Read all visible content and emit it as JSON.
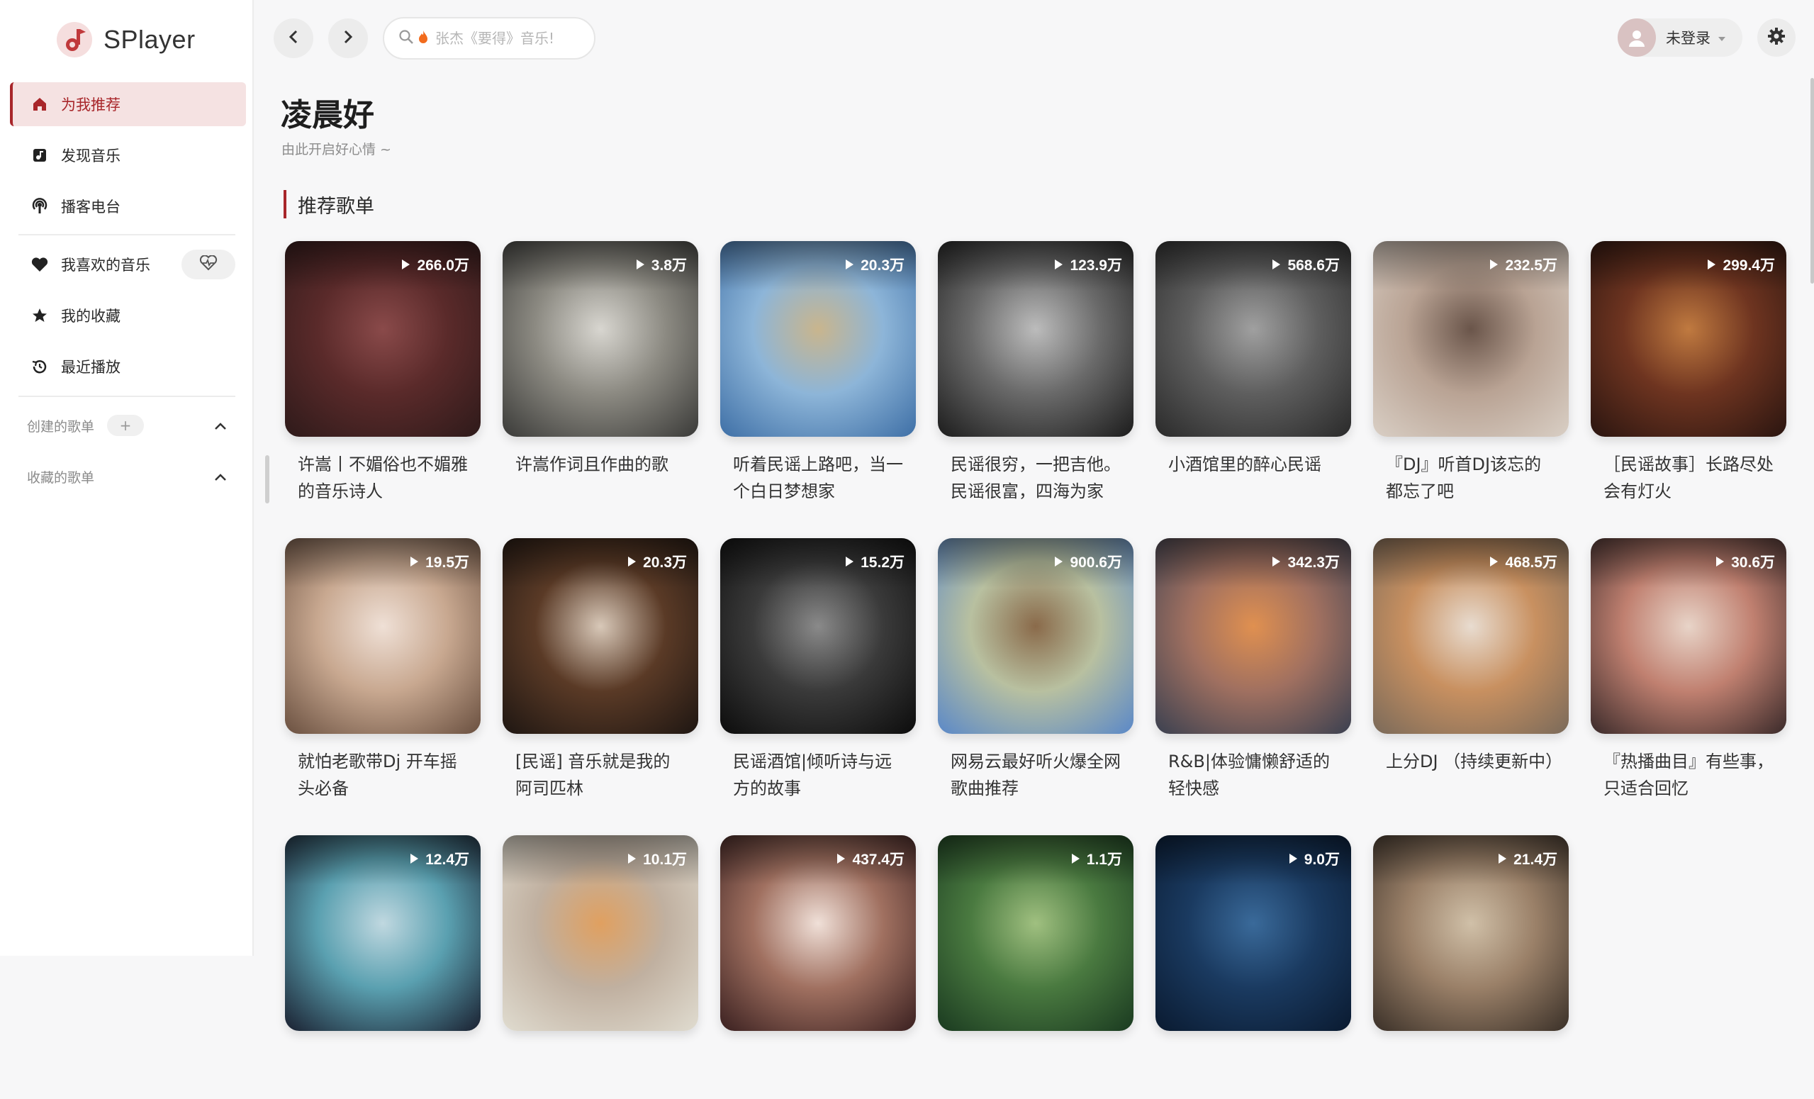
{
  "app": {
    "name": "SPlayer"
  },
  "sidebar": {
    "nav": [
      {
        "label": "为我推荐",
        "icon": "home-icon"
      },
      {
        "label": "发现音乐",
        "icon": "music-note-icon"
      },
      {
        "label": "播客电台",
        "icon": "podcast-icon"
      }
    ],
    "library": [
      {
        "label": "我喜欢的音乐",
        "icon": "heart-icon"
      },
      {
        "label": "我的收藏",
        "icon": "star-icon"
      },
      {
        "label": "最近播放",
        "icon": "history-icon"
      }
    ],
    "created_playlists": "创建的歌单",
    "collected_playlists": "收藏的歌单",
    "plus_label": "+"
  },
  "topbar": {
    "search_placeholder": "张杰《要得》音乐!",
    "user_label": "未登录"
  },
  "main": {
    "greeting": "凌晨好",
    "subtitle": "由此开启好心情 ~",
    "section_title": "推荐歌单",
    "playlists": [
      {
        "count": "266.0万",
        "title": "许嵩丨不媚俗也不媚雅的音乐诗人",
        "colors": [
          "#2e1a1a",
          "#5a2a2a",
          "#8a4a4a"
        ]
      },
      {
        "count": "3.8万",
        "title": "许嵩作词且作曲的歌",
        "colors": [
          "#3a3a38",
          "#8c8a82",
          "#d8d6d0"
        ]
      },
      {
        "count": "20.3万",
        "title": "听着民谣上路吧，当一个白日梦想家",
        "colors": [
          "#3e6fa6",
          "#8db5d8",
          "#c9b58d"
        ]
      },
      {
        "count": "123.9万",
        "title": "民谣很穷，一把吉他。民谣很富，四海为家",
        "colors": [
          "#1c1c1c",
          "#6a6a6a",
          "#bcbcbc"
        ]
      },
      {
        "count": "568.6万",
        "title": "小酒馆里的醉心民谣",
        "colors": [
          "#2a2a2a",
          "#5e5e5e",
          "#a0a0a0"
        ]
      },
      {
        "count": "232.5万",
        "title": "『DJ』听首DJ该忘的都忘了吧",
        "colors": [
          "#d9cfc5",
          "#b9a394",
          "#6a554a"
        ]
      },
      {
        "count": "299.4万",
        "title": "［民谣故事］长路尽处会有灯火",
        "colors": [
          "#2a1510",
          "#6e3420",
          "#c07a40"
        ]
      },
      {
        "count": "19.5万",
        "title": "就怕老歌带Dj 开车摇头必备",
        "colors": [
          "#6a5040",
          "#c8a890",
          "#efe0d6"
        ]
      },
      {
        "count": "20.3万",
        "title": "[民谣] 音乐就是我的阿司匹林",
        "colors": [
          "#1e1612",
          "#5a3a26",
          "#d8c8b8"
        ]
      },
      {
        "count": "15.2万",
        "title": "民谣酒馆|倾听诗与远方的故事",
        "colors": [
          "#0c0c0c",
          "#3a3a3a",
          "#8a8a8a"
        ]
      },
      {
        "count": "900.6万",
        "title": "网易云最好听火爆全网歌曲推荐",
        "colors": [
          "#5a88c8",
          "#b8c0a0",
          "#8a6a4a"
        ]
      },
      {
        "count": "342.3万",
        "title": "R&B|体验慵懒舒适的轻快感",
        "colors": [
          "#3a4050",
          "#a07060",
          "#e09050"
        ]
      },
      {
        "count": "468.5万",
        "title": "上分DJ （持续更新中）",
        "colors": [
          "#7a6a5a",
          "#c89060",
          "#e8dcd0"
        ]
      },
      {
        "count": "30.6万",
        "title": "『热播曲目』有些事，只适合回忆",
        "colors": [
          "#3a2a2a",
          "#c08070",
          "#e8d4c8"
        ]
      },
      {
        "count": "12.4万",
        "title": "",
        "colors": [
          "#1a2030",
          "#5aa0b0",
          "#c0d8e0"
        ]
      },
      {
        "count": "10.1万",
        "title": "",
        "colors": [
          "#e0dcd0",
          "#c0b0a0",
          "#e0a060"
        ]
      },
      {
        "count": "437.4万",
        "title": "",
        "colors": [
          "#3a2020",
          "#a07060",
          "#f0e0d8"
        ]
      },
      {
        "count": "1.1万",
        "title": "",
        "colors": [
          "#1a3a20",
          "#4a7a40",
          "#a0c080"
        ]
      },
      {
        "count": "9.0万",
        "title": "",
        "colors": [
          "#0a1a30",
          "#1a3a60",
          "#3a6a9a"
        ]
      },
      {
        "count": "21.4万",
        "title": "",
        "colors": [
          "#3a3028",
          "#9a8068",
          "#d0c0a8"
        ]
      }
    ]
  }
}
